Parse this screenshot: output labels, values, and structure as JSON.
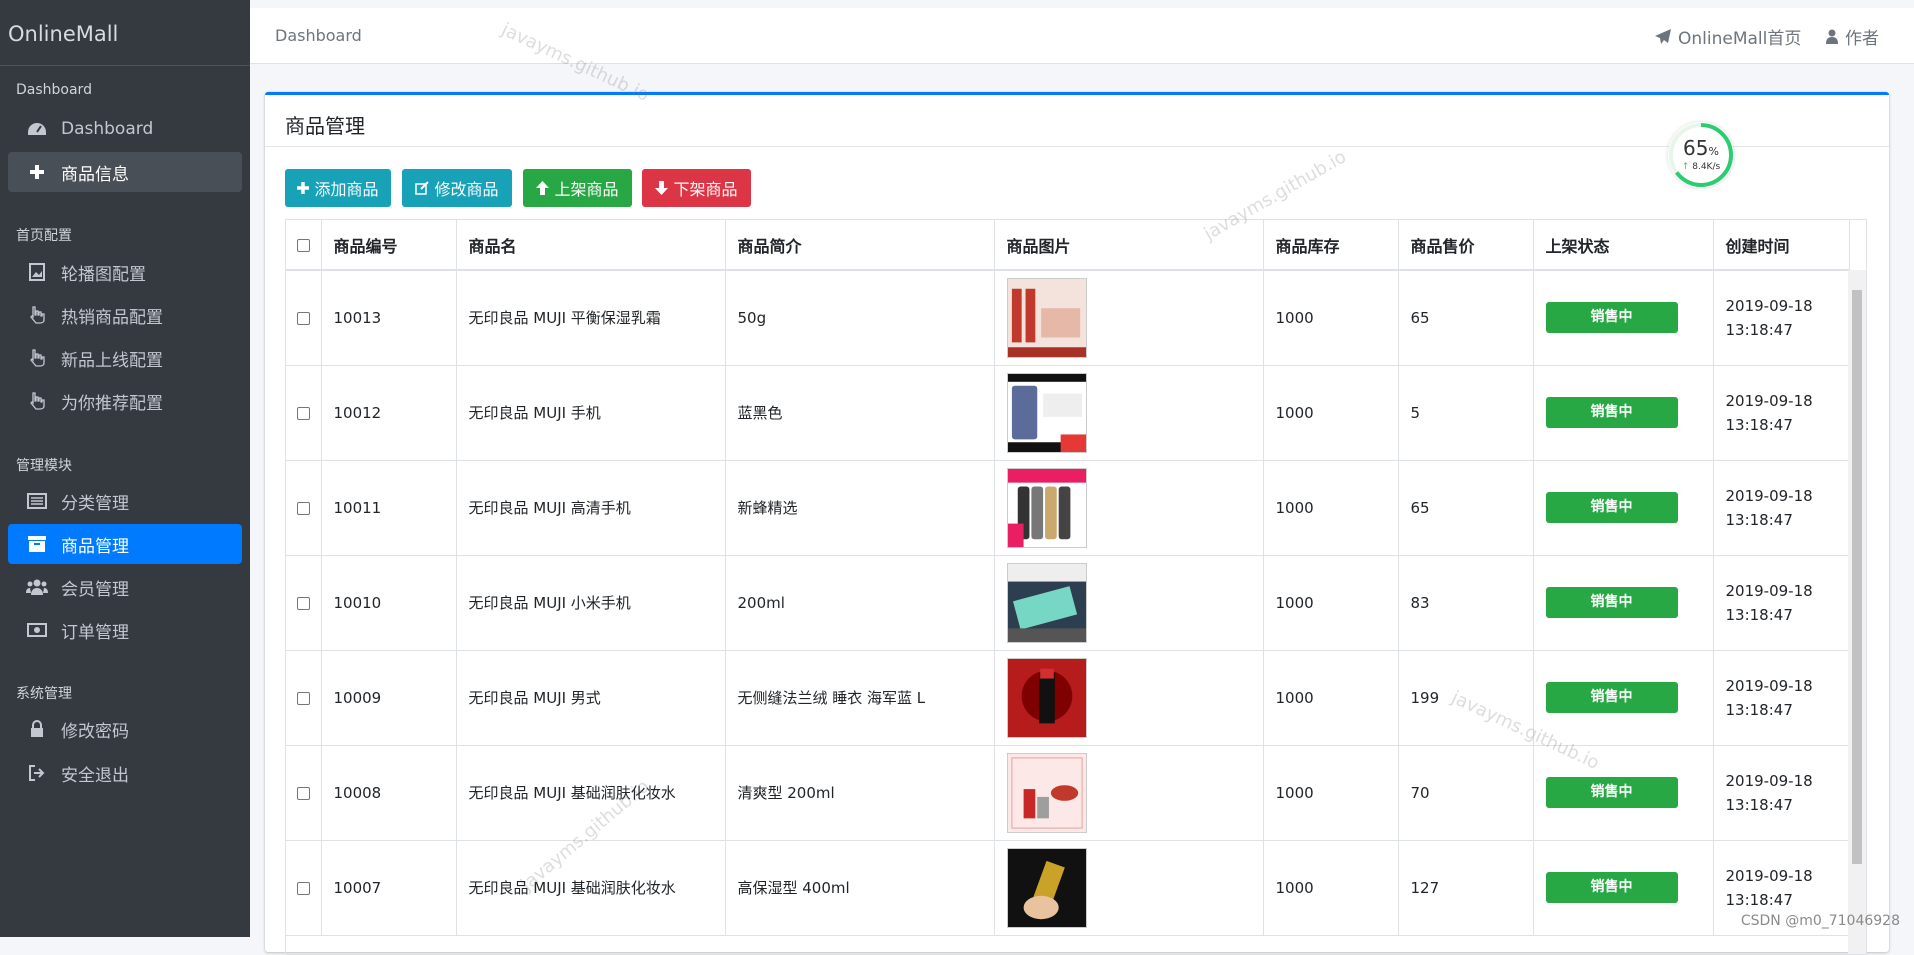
{
  "brand": "OnlineMall",
  "sidebar": {
    "sections": [
      {
        "header": "Dashboard",
        "items": [
          {
            "label": "Dashboard",
            "icon": "dashboard-icon"
          },
          {
            "label": "商品信息",
            "icon": "plus-icon"
          }
        ]
      },
      {
        "header": "首页配置",
        "items": [
          {
            "label": "轮播图配置",
            "icon": "image-icon"
          },
          {
            "label": "热销商品配置",
            "icon": "hand-icon"
          },
          {
            "label": "新品上线配置",
            "icon": "hand-icon"
          },
          {
            "label": "为你推荐配置",
            "icon": "hand-icon"
          }
        ]
      },
      {
        "header": "管理模块",
        "items": [
          {
            "label": "分类管理",
            "icon": "list-icon"
          },
          {
            "label": "商品管理",
            "icon": "archive-icon"
          },
          {
            "label": "会员管理",
            "icon": "users-icon"
          },
          {
            "label": "订单管理",
            "icon": "money-icon"
          }
        ]
      },
      {
        "header": "系统管理",
        "items": [
          {
            "label": "修改密码",
            "icon": "lock-icon"
          },
          {
            "label": "安全退出",
            "icon": "sign-out-icon"
          }
        ]
      }
    ]
  },
  "topbar": {
    "breadcrumb": "Dashboard",
    "home_link": "OnlineMall首页",
    "author_link": "作者"
  },
  "card": {
    "title": "商品管理"
  },
  "toolbar": {
    "add": "添加商品",
    "edit": "修改商品",
    "put_on": "上架商品",
    "put_off": "下架商品"
  },
  "table": {
    "headers": [
      "商品编号",
      "商品名",
      "商品简介",
      "商品图片",
      "商品库存",
      "商品售价",
      "上架状态",
      "创建时间"
    ],
    "rows": [
      {
        "id": "10013",
        "name": "无印良品 MUJI 平衡保湿乳霜",
        "intro": "50g",
        "stock": "1000",
        "price": "65",
        "status": "销售中",
        "date": "2019-09-18",
        "time": "13:18:47"
      },
      {
        "id": "10012",
        "name": "无印良品 MUJI 手机",
        "intro": "蓝黑色",
        "stock": "1000",
        "price": "5",
        "status": "销售中",
        "date": "2019-09-18",
        "time": "13:18:47"
      },
      {
        "id": "10011",
        "name": "无印良品 MUJI 高清手机",
        "intro": "新蜂精选",
        "stock": "1000",
        "price": "65",
        "status": "销售中",
        "date": "2019-09-18",
        "time": "13:18:47"
      },
      {
        "id": "10010",
        "name": "无印良品 MUJI 小米手机",
        "intro": "200ml",
        "stock": "1000",
        "price": "83",
        "status": "销售中",
        "date": "2019-09-18",
        "time": "13:18:47"
      },
      {
        "id": "10009",
        "name": "无印良品 MUJI 男式",
        "intro": "无侧缝法兰绒 睡衣 海军蓝 L",
        "stock": "1000",
        "price": "199",
        "status": "销售中",
        "date": "2019-09-18",
        "time": "13:18:47"
      },
      {
        "id": "10008",
        "name": "无印良品 MUJI 基础润肤化妆水",
        "intro": "清爽型 200ml",
        "stock": "1000",
        "price": "70",
        "status": "销售中",
        "date": "2019-09-18",
        "time": "13:18:47"
      },
      {
        "id": "10007",
        "name": "无印良品 MUJI 基础润肤化妆水",
        "intro": "高保湿型 400ml",
        "stock": "1000",
        "price": "127",
        "status": "销售中",
        "date": "2019-09-18",
        "time": "13:18:47"
      }
    ]
  },
  "gauge": {
    "value": "65",
    "unit": "%",
    "speed": "8.4K/s",
    "fraction": 0.65
  },
  "watermark": "javayms.github.io",
  "footer_credit": "CSDN @m0_71046928",
  "colors": {
    "primary": "#007bff",
    "info": "#17a2b8",
    "success": "#28a745",
    "danger": "#dc3545",
    "sidebar": "#343a40"
  }
}
